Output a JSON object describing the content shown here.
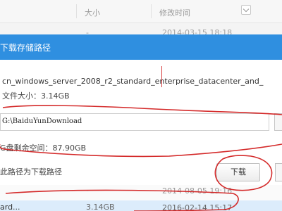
{
  "file_list": {
    "columns": {
      "size": "大小",
      "modified": "修改时间"
    },
    "rows": [
      {
        "size": "-",
        "modified": "2014-03-15 18:18"
      },
      {
        "size": "-",
        "modified": "2014-08-05 19:16"
      }
    ],
    "selected_row": {
      "name": "ard...",
      "size": "3.14GB",
      "modified": "2016-02-14 15:17"
    }
  },
  "dialog": {
    "title": "下载存储路径",
    "file_name": "cn_windows_server_2008_r2_standard_enterprise_datacenter_and_",
    "file_size_label": "文件大小：3.14GB",
    "path_value": "G:\\BaiduYunDownload",
    "free_space_label": "G盘剩余空间：87.90GB",
    "default_path_label": "此路径为下载路径",
    "download_button": "下载"
  },
  "colors": {
    "titlebar": "#2f8fe0",
    "annotation": "#d42a2a",
    "selected_row": "#dcecfb"
  }
}
